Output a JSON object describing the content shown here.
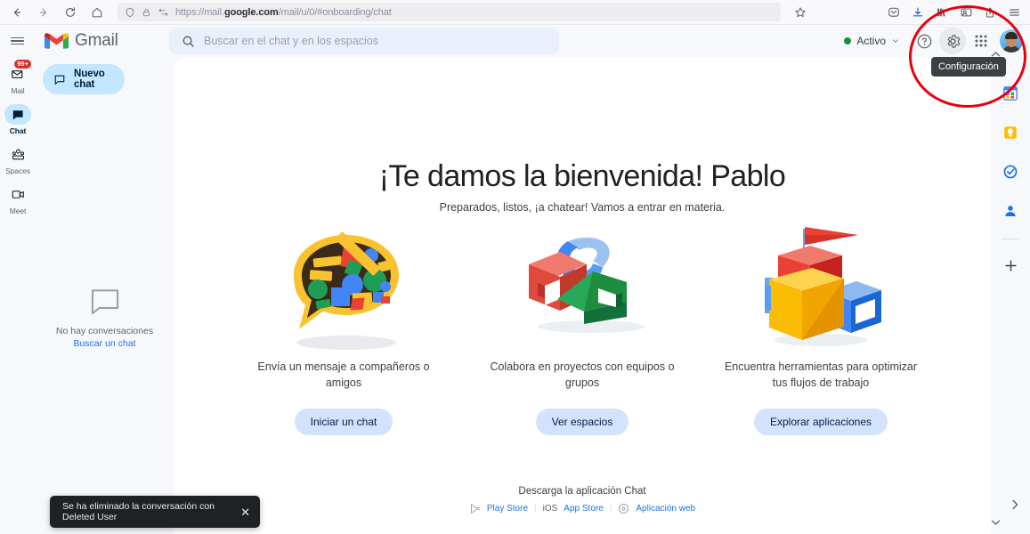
{
  "browser": {
    "url_prefix": "https://mail.",
    "url_domain": "google.com",
    "url_suffix": "/mail/u/0/#onboarding/chat",
    "icons": {
      "back": "back-arrow-icon",
      "forward": "forward-arrow-icon",
      "reload": "reload-icon",
      "home": "home-icon",
      "shield": "shield-icon",
      "lock": "lock-icon",
      "reader": "reader-mode-icon",
      "bookmark": "star-bookmark-icon",
      "pocket": "pocket-save-icon",
      "download": "download-arrow-icon",
      "library": "library-icon",
      "account": "account-icon",
      "share": "share-icon",
      "menu": "hamburger-menu-icon"
    }
  },
  "header": {
    "app_name": "Gmail",
    "search_placeholder": "Buscar en el chat y en los espacios",
    "status_label": "Activo",
    "status_color": "#1e8e3e",
    "tooltip": "Configuración"
  },
  "rail": {
    "items": [
      {
        "label": "Mail",
        "icon": "mail-icon",
        "badge": "99+",
        "selected": false
      },
      {
        "label": "Chat",
        "icon": "chat-icon",
        "badge": "",
        "selected": true
      },
      {
        "label": "Spaces",
        "icon": "spaces-icon",
        "badge": "",
        "selected": false
      },
      {
        "label": "Meet",
        "icon": "meet-icon",
        "badge": "",
        "selected": false
      }
    ]
  },
  "chat_panel": {
    "new_chat_label": "Nuevo chat",
    "empty_text": "No hay conversaciones",
    "empty_link": "Buscar un chat"
  },
  "main": {
    "welcome_title": "¡Te damos la bienvenida! Pablo",
    "welcome_subtitle": "Preparados, listos, ¡a chatear! Vamos a entrar en materia.",
    "cards": [
      {
        "art": "speech-bubble-blocks-illustration",
        "text": "Envía un mensaje a compañeros o amigos",
        "button": "Iniciar un chat"
      },
      {
        "art": "shapes-collaboration-illustration",
        "text": "Colabora en proyectos con equipos o grupos",
        "button": "Ver espacios"
      },
      {
        "art": "blocks-flag-tools-illustration",
        "text": "Encuentra herramientas para optimizar tus flujos de trabajo",
        "button": "Explorar aplicaciones"
      }
    ],
    "download": {
      "title": "Descarga la aplicación Chat",
      "play_store": "Play Store",
      "ios": "iOS",
      "app_store": "App Store",
      "web_app": "Aplicación web"
    }
  },
  "right_rail": {
    "items": [
      {
        "icon": "google-calendar-icon"
      },
      {
        "icon": "google-keep-icon"
      },
      {
        "icon": "google-tasks-icon"
      },
      {
        "icon": "google-contacts-icon"
      }
    ],
    "add_label": "+"
  },
  "toast": {
    "message": "Se ha eliminado la conversación con Deleted User",
    "close": "✕"
  },
  "annotation": {
    "color": "#e8000d",
    "shape": "ellipse"
  }
}
